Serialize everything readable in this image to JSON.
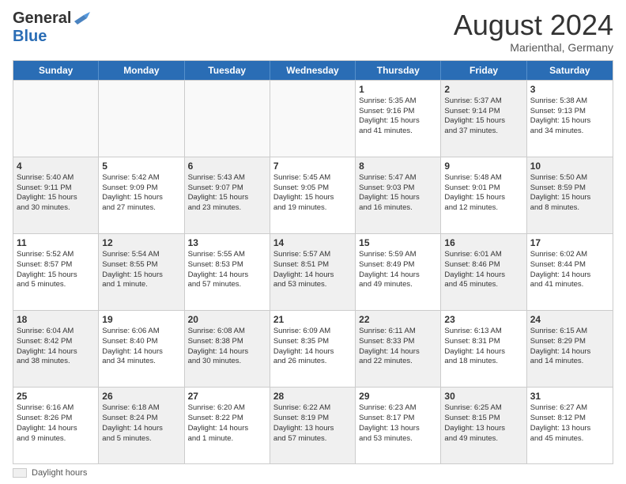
{
  "header": {
    "logo_general": "General",
    "logo_blue": "Blue",
    "month_title": "August 2024",
    "subtitle": "Marienthal, Germany"
  },
  "footer": {
    "legend_label": "Daylight hours"
  },
  "calendar": {
    "weekdays": [
      "Sunday",
      "Monday",
      "Tuesday",
      "Wednesday",
      "Thursday",
      "Friday",
      "Saturday"
    ],
    "rows": [
      [
        {
          "day": "",
          "text": "",
          "empty": true
        },
        {
          "day": "",
          "text": "",
          "empty": true
        },
        {
          "day": "",
          "text": "",
          "empty": true
        },
        {
          "day": "",
          "text": "",
          "empty": true
        },
        {
          "day": "1",
          "text": "Sunrise: 5:35 AM\nSunset: 9:16 PM\nDaylight: 15 hours\nand 41 minutes.",
          "shaded": false
        },
        {
          "day": "2",
          "text": "Sunrise: 5:37 AM\nSunset: 9:14 PM\nDaylight: 15 hours\nand 37 minutes.",
          "shaded": true
        },
        {
          "day": "3",
          "text": "Sunrise: 5:38 AM\nSunset: 9:13 PM\nDaylight: 15 hours\nand 34 minutes.",
          "shaded": false
        }
      ],
      [
        {
          "day": "4",
          "text": "Sunrise: 5:40 AM\nSunset: 9:11 PM\nDaylight: 15 hours\nand 30 minutes.",
          "shaded": true
        },
        {
          "day": "5",
          "text": "Sunrise: 5:42 AM\nSunset: 9:09 PM\nDaylight: 15 hours\nand 27 minutes.",
          "shaded": false
        },
        {
          "day": "6",
          "text": "Sunrise: 5:43 AM\nSunset: 9:07 PM\nDaylight: 15 hours\nand 23 minutes.",
          "shaded": true
        },
        {
          "day": "7",
          "text": "Sunrise: 5:45 AM\nSunset: 9:05 PM\nDaylight: 15 hours\nand 19 minutes.",
          "shaded": false
        },
        {
          "day": "8",
          "text": "Sunrise: 5:47 AM\nSunset: 9:03 PM\nDaylight: 15 hours\nand 16 minutes.",
          "shaded": true
        },
        {
          "day": "9",
          "text": "Sunrise: 5:48 AM\nSunset: 9:01 PM\nDaylight: 15 hours\nand 12 minutes.",
          "shaded": false
        },
        {
          "day": "10",
          "text": "Sunrise: 5:50 AM\nSunset: 8:59 PM\nDaylight: 15 hours\nand 8 minutes.",
          "shaded": true
        }
      ],
      [
        {
          "day": "11",
          "text": "Sunrise: 5:52 AM\nSunset: 8:57 PM\nDaylight: 15 hours\nand 5 minutes.",
          "shaded": false
        },
        {
          "day": "12",
          "text": "Sunrise: 5:54 AM\nSunset: 8:55 PM\nDaylight: 15 hours\nand 1 minute.",
          "shaded": true
        },
        {
          "day": "13",
          "text": "Sunrise: 5:55 AM\nSunset: 8:53 PM\nDaylight: 14 hours\nand 57 minutes.",
          "shaded": false
        },
        {
          "day": "14",
          "text": "Sunrise: 5:57 AM\nSunset: 8:51 PM\nDaylight: 14 hours\nand 53 minutes.",
          "shaded": true
        },
        {
          "day": "15",
          "text": "Sunrise: 5:59 AM\nSunset: 8:49 PM\nDaylight: 14 hours\nand 49 minutes.",
          "shaded": false
        },
        {
          "day": "16",
          "text": "Sunrise: 6:01 AM\nSunset: 8:46 PM\nDaylight: 14 hours\nand 45 minutes.",
          "shaded": true
        },
        {
          "day": "17",
          "text": "Sunrise: 6:02 AM\nSunset: 8:44 PM\nDaylight: 14 hours\nand 41 minutes.",
          "shaded": false
        }
      ],
      [
        {
          "day": "18",
          "text": "Sunrise: 6:04 AM\nSunset: 8:42 PM\nDaylight: 14 hours\nand 38 minutes.",
          "shaded": true
        },
        {
          "day": "19",
          "text": "Sunrise: 6:06 AM\nSunset: 8:40 PM\nDaylight: 14 hours\nand 34 minutes.",
          "shaded": false
        },
        {
          "day": "20",
          "text": "Sunrise: 6:08 AM\nSunset: 8:38 PM\nDaylight: 14 hours\nand 30 minutes.",
          "shaded": true
        },
        {
          "day": "21",
          "text": "Sunrise: 6:09 AM\nSunset: 8:35 PM\nDaylight: 14 hours\nand 26 minutes.",
          "shaded": false
        },
        {
          "day": "22",
          "text": "Sunrise: 6:11 AM\nSunset: 8:33 PM\nDaylight: 14 hours\nand 22 minutes.",
          "shaded": true
        },
        {
          "day": "23",
          "text": "Sunrise: 6:13 AM\nSunset: 8:31 PM\nDaylight: 14 hours\nand 18 minutes.",
          "shaded": false
        },
        {
          "day": "24",
          "text": "Sunrise: 6:15 AM\nSunset: 8:29 PM\nDaylight: 14 hours\nand 14 minutes.",
          "shaded": true
        }
      ],
      [
        {
          "day": "25",
          "text": "Sunrise: 6:16 AM\nSunset: 8:26 PM\nDaylight: 14 hours\nand 9 minutes.",
          "shaded": false
        },
        {
          "day": "26",
          "text": "Sunrise: 6:18 AM\nSunset: 8:24 PM\nDaylight: 14 hours\nand 5 minutes.",
          "shaded": true
        },
        {
          "day": "27",
          "text": "Sunrise: 6:20 AM\nSunset: 8:22 PM\nDaylight: 14 hours\nand 1 minute.",
          "shaded": false
        },
        {
          "day": "28",
          "text": "Sunrise: 6:22 AM\nSunset: 8:19 PM\nDaylight: 13 hours\nand 57 minutes.",
          "shaded": true
        },
        {
          "day": "29",
          "text": "Sunrise: 6:23 AM\nSunset: 8:17 PM\nDaylight: 13 hours\nand 53 minutes.",
          "shaded": false
        },
        {
          "day": "30",
          "text": "Sunrise: 6:25 AM\nSunset: 8:15 PM\nDaylight: 13 hours\nand 49 minutes.",
          "shaded": true
        },
        {
          "day": "31",
          "text": "Sunrise: 6:27 AM\nSunset: 8:12 PM\nDaylight: 13 hours\nand 45 minutes.",
          "shaded": false
        }
      ]
    ]
  }
}
